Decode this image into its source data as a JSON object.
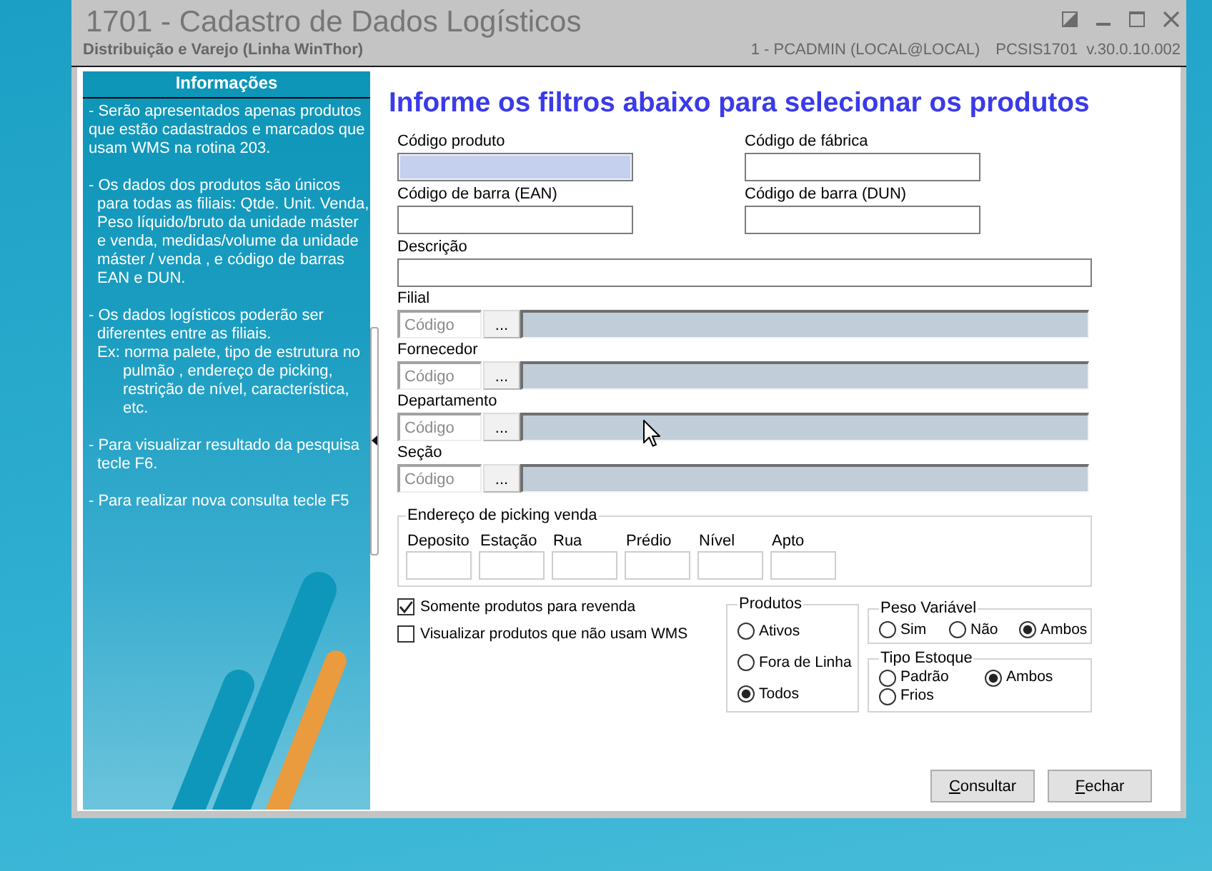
{
  "window": {
    "title": "1701 - Cadastro de Dados Logísticos",
    "subtitle": "Distribuição e Varejo (Linha WinThor)",
    "session": "1 - PCADMIN (LOCAL@LOCAL)",
    "program": "PCSIS1701",
    "version": "v.30.0.10.002"
  },
  "info_panel": {
    "title": "Informações",
    "paragraphs": [
      {
        "kind": "plain",
        "text": "- Serão apresentados apenas produtos\nque estão cadastrados e marcados que\nusam WMS na rotina 203."
      },
      {
        "kind": "hanging",
        "text": "- Os dados dos produtos são únicos\npara todas as filiais: Qtde. Unit. Venda,\nPeso líquido/bruto da unidade máster\ne venda, medidas/volume da unidade\nmáster / venda , e código de barras\nEAN e DUN."
      },
      {
        "kind": "hanging",
        "text": "- Os dados logísticos poderão ser\ndiferentes entre as filiais.",
        "example": "Ex: norma palete, tipo de estrutura no\npulmão , endereço de picking,\nrestrição de nível, característica,\netc."
      },
      {
        "kind": "hanging",
        "text": "- Para visualizar resultado da pesquisa\ntecle F6."
      },
      {
        "kind": "hanging",
        "text": "- Para realizar nova consulta tecle F5"
      }
    ]
  },
  "form": {
    "heading": "Informe os filtros abaixo para selecionar os produtos",
    "fields": [
      {
        "label": "Código produto",
        "kind": "half",
        "focused": true
      },
      {
        "label": "Código de fábrica",
        "kind": "half",
        "focused": false
      },
      {
        "label": "Código de barra (EAN)",
        "kind": "half",
        "focused": false
      },
      {
        "label": "Código de barra (DUN)",
        "kind": "half",
        "focused": false
      },
      {
        "label": "Descrição",
        "kind": "full",
        "focused": false
      }
    ],
    "lookups": [
      {
        "label": "Filial",
        "placeholder": "Código",
        "button": "..."
      },
      {
        "label": "Fornecedor",
        "placeholder": "Código",
        "button": "..."
      },
      {
        "label": "Departamento",
        "placeholder": "Código",
        "button": "..."
      },
      {
        "label": "Seção",
        "placeholder": "Código",
        "button": "..."
      }
    ],
    "picking": {
      "title": "Endereço de picking venda",
      "fields": [
        "Deposito",
        "Estação",
        "Rua",
        "Prédio",
        "Nível",
        "Apto"
      ]
    },
    "checkboxes": [
      {
        "label": "Somente produtos para revenda",
        "checked": true
      },
      {
        "label": "Visualizar produtos que não usam WMS",
        "checked": false
      }
    ],
    "radio_groups": [
      {
        "title": "Produtos",
        "kind": "column",
        "options": [
          {
            "label": "Ativos",
            "selected": false
          },
          {
            "label": "Fora de Linha",
            "selected": false
          },
          {
            "label": "Todos",
            "selected": true
          }
        ]
      },
      {
        "title": "Peso Variável",
        "kind": "row",
        "options": [
          {
            "label": "Sim",
            "selected": false
          },
          {
            "label": "Não",
            "selected": false
          },
          {
            "label": "Ambos",
            "selected": true
          }
        ]
      },
      {
        "title": "Tipo Estoque",
        "kind": "grid",
        "options": [
          {
            "label": "Padrão",
            "selected": false
          },
          {
            "label": "Ambos",
            "selected": true
          },
          {
            "label": "Frios",
            "selected": false
          }
        ]
      }
    ],
    "buttons": [
      "Consultar",
      "Fechar"
    ]
  }
}
